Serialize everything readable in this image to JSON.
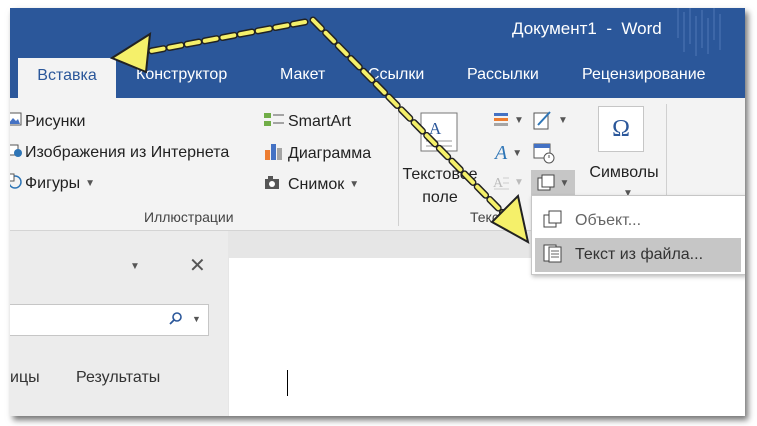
{
  "window": {
    "title": "Документ1  -  Word"
  },
  "tabs": [
    {
      "label": "Вставка",
      "active": true
    },
    {
      "label": "Конструктор"
    },
    {
      "label": "Макет"
    },
    {
      "label": "Ссылки"
    },
    {
      "label": "Рассылки"
    },
    {
      "label": "Рецензирование"
    }
  ],
  "ribbon": {
    "illustrations": {
      "pictures": "Рисунки",
      "online_pictures": "Изображения из Интернета",
      "shapes": "Фигуры",
      "smartart": "SmartArt",
      "chart": "Диаграмма",
      "screenshot": "Снимок",
      "group_label": "Иллюстрации"
    },
    "text": {
      "textbox_line1": "Текстовое",
      "textbox_line2": "поле",
      "group_label": "Текст"
    },
    "symbols": {
      "label": "Символы",
      "omega": "Ω"
    }
  },
  "object_menu": {
    "items": [
      {
        "label": "Объект..."
      },
      {
        "label": "Текст из файла...",
        "highlighted": true
      }
    ]
  },
  "nav_pane": {
    "tab_pages": "ицы",
    "tab_results": "Результаты"
  },
  "colors": {
    "accent": "#2b579a",
    "arrow_fill": "#f5f06a",
    "menu_highlight": "#c6c6c6"
  },
  "icons": [
    "picture-icon",
    "online-picture-icon",
    "shapes-icon",
    "smartart-icon",
    "chart-icon",
    "screenshot-icon",
    "textbox-icon",
    "wordart-icon",
    "object-icon",
    "text-from-file-icon",
    "omega-icon",
    "close-icon",
    "search-icon"
  ]
}
